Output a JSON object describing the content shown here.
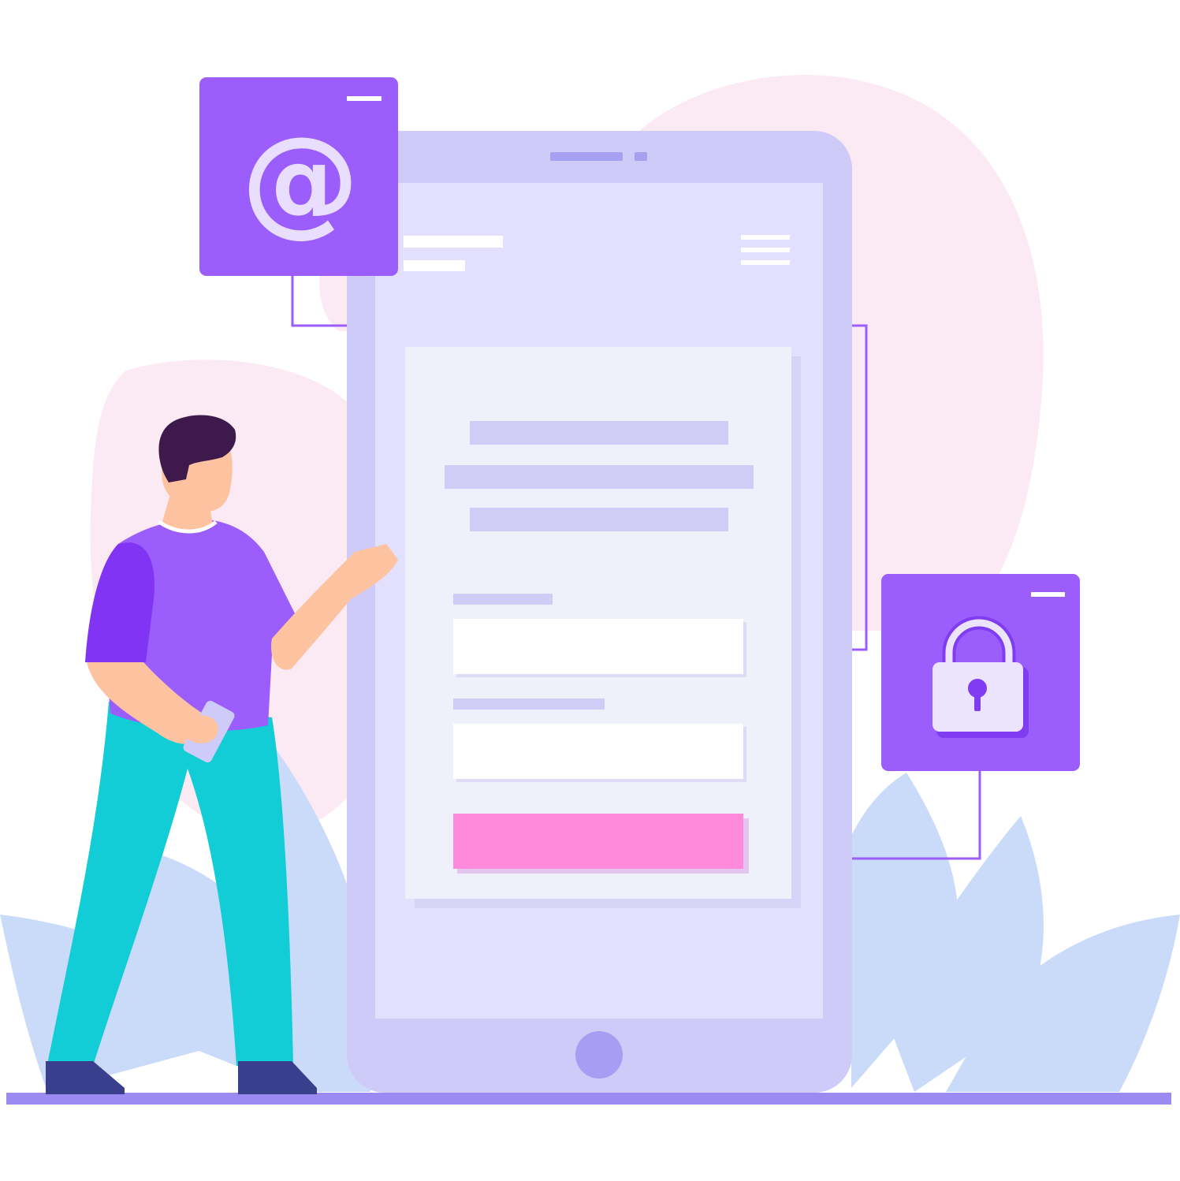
{
  "illustration": {
    "email_card": {
      "icon": "at-sign-icon",
      "glyph": "@"
    },
    "password_card": {
      "icon": "padlock-icon"
    },
    "phone": {
      "form_fields": 2,
      "button": "login-button"
    }
  },
  "colors": {
    "primary_purple": "#9B5DFB",
    "phone_body": "#CFCBF8",
    "phone_screen": "#E2E0FC",
    "form_panel": "#EEF0FA",
    "placeholder_bar": "#D0CCF6",
    "login_button": "#FF8ADB",
    "blob_pink": "#FBEAF4",
    "leaf_blue": "#CADBFA",
    "connector_line": "#9B5DFB",
    "ground_line": "#9B8AF2",
    "hair": "#3E1A4C",
    "skin": "#FDC3A1",
    "shirt": "#9B5DFB",
    "pants": "#12CCD6",
    "shoes": "#393F8C"
  }
}
